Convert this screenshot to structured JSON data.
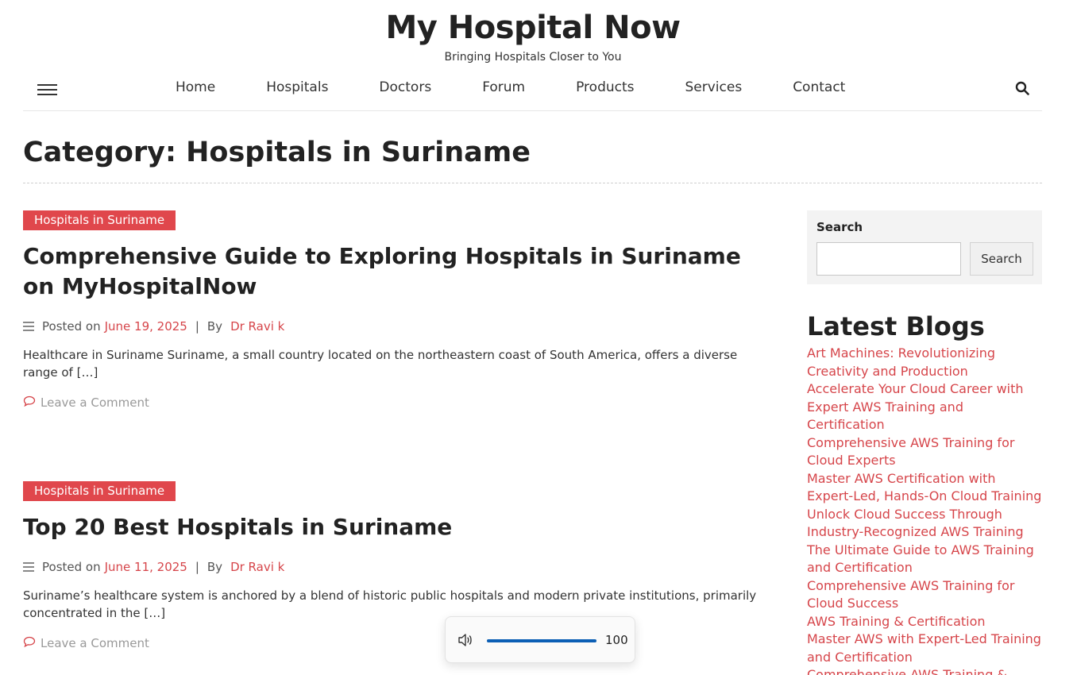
{
  "header": {
    "site_title": "My Hospital Now",
    "tagline": "Bringing Hospitals Closer to You"
  },
  "nav": {
    "items": [
      "Home",
      "Hospitals",
      "Doctors",
      "Forum",
      "Products",
      "Services",
      "Contact"
    ],
    "menu_icon": "hamburger-icon",
    "search_icon": "search-icon"
  },
  "page": {
    "title": "Category: Hospitals in Suriname"
  },
  "posts": [
    {
      "category": "Hospitals in Suriname",
      "title": "Comprehensive Guide to Exploring Hospitals in Suriname on MyHospitalNow",
      "posted_on_label": "Posted on",
      "date": "June 19, 2025",
      "separator": "|",
      "by_label": "By",
      "author": "Dr Ravi k",
      "excerpt": "Healthcare in Suriname Suriname, a small country located on the northeastern coast of South America, offers a diverse range of […]",
      "comment_label": "Leave a Comment"
    },
    {
      "category": "Hospitals in Suriname",
      "title": "Top 20 Best Hospitals in Suriname",
      "posted_on_label": "Posted on",
      "date": "June 11, 2025",
      "separator": "|",
      "by_label": "By",
      "author": "Dr Ravi k",
      "excerpt": "Suriname’s healthcare system is anchored by a blend of historic public hospitals and modern private institutions, primarily concentrated in the […]",
      "comment_label": "Leave a Comment"
    }
  ],
  "sidebar": {
    "search_label": "Search",
    "search_input_value": "",
    "search_button": "Search",
    "latest_blogs_title": "Latest Blogs",
    "latest_blogs": [
      "Art Machines: Revolutionizing Creativity and Production",
      "Accelerate Your Cloud Career with Expert AWS Training and Certification",
      "Comprehensive AWS Training for Cloud Experts",
      "Master AWS Certification with Expert-Led, Hands-On Cloud Training",
      "Unlock Cloud Success Through Industry-Recognized AWS Training",
      "The Ultimate Guide to AWS Training and Certification",
      "Comprehensive AWS Training for Cloud Success",
      "AWS Training & Certification",
      "Master AWS with Expert-Led Training and Certification",
      "Comprehensive AWS Training &"
    ]
  },
  "volume_overlay": {
    "icon": "speaker-icon",
    "level": 100,
    "level_text": "100"
  },
  "colors": {
    "accent": "#e0474c",
    "link": "#d6454a",
    "volume_fill": "#0c5fb5"
  }
}
